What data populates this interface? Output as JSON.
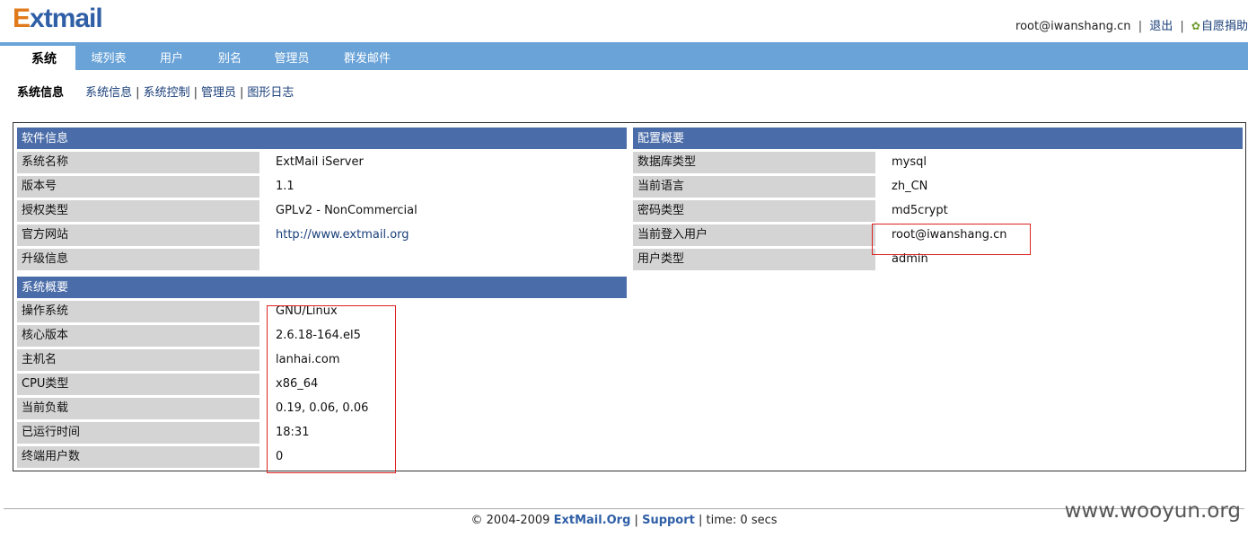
{
  "header": {
    "logo": {
      "first_letter": "E",
      "rest": "xtmail"
    },
    "user": "root@iwanshang.cn",
    "separator": "|",
    "logout": "退出",
    "donate": "自愿捐助",
    "donate_icon": "gear-icon"
  },
  "tabs": [
    "系统",
    "域列表",
    "用户",
    "别名",
    "管理员",
    "群发邮件"
  ],
  "subnav": {
    "title": "系统信息",
    "links": [
      "系统信息",
      "系统控制",
      "管理员",
      "图形日志"
    ],
    "separator": "|"
  },
  "software": {
    "header": "软件信息",
    "rows": [
      {
        "label": "系统名称",
        "value": "ExtMail iServer"
      },
      {
        "label": "版本号",
        "value": "1.1"
      },
      {
        "label": "授权类型",
        "value": "GPLv2 - NonCommercial"
      },
      {
        "label": "官方网站",
        "value": "http://www.extmail.org"
      },
      {
        "label": "升级信息",
        "value": ""
      }
    ]
  },
  "system": {
    "header": "系统概要",
    "rows": [
      {
        "label": "操作系统",
        "value": "GNU/Linux"
      },
      {
        "label": "核心版本",
        "value": "2.6.18-164.el5"
      },
      {
        "label": "主机名",
        "value": "lanhai.com"
      },
      {
        "label": "CPU类型",
        "value": "x86_64"
      },
      {
        "label": "当前负载",
        "value": "0.19, 0.06, 0.06"
      },
      {
        "label": "已运行时间",
        "value": "18:31"
      },
      {
        "label": "终端用户数",
        "value": "0"
      }
    ]
  },
  "config": {
    "header": "配置概要",
    "rows": [
      {
        "label": "数据库类型",
        "value": "mysql"
      },
      {
        "label": "当前语言",
        "value": "zh_CN"
      },
      {
        "label": "密码类型",
        "value": "md5crypt"
      },
      {
        "label": "当前登入用户",
        "value": "root@iwanshang.cn"
      },
      {
        "label": "用户类型",
        "value": "admin"
      }
    ]
  },
  "footer": {
    "copyright": "© 2004-2009",
    "site": "ExtMail.Org",
    "sep": "|",
    "support": "Support",
    "time": "time: 0 secs"
  },
  "watermark": "www.wooyun.org",
  "colors": {
    "nav": "#6aa3d8",
    "section_header": "#4a6ca8",
    "label_bg": "#d4d4d4",
    "highlight": "#dd2222",
    "logo_e": "#e07a1a",
    "logo_text": "#2f5fa6"
  }
}
